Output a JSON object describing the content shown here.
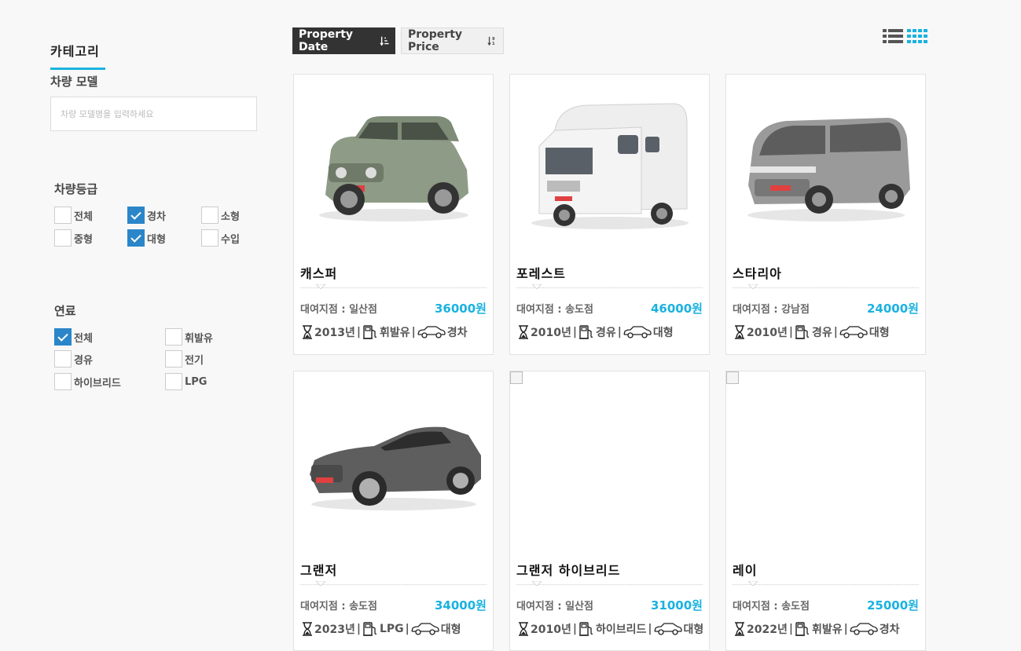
{
  "sidebar": {
    "category_title": "카테고리",
    "model_title": "차량 모델",
    "model_placeholder": "차량 모델명을 입력하세요",
    "grade_title": "차량등급",
    "grades": [
      {
        "label": "전체",
        "checked": false
      },
      {
        "label": "경차",
        "checked": true
      },
      {
        "label": "소형",
        "checked": false
      },
      {
        "label": "중형",
        "checked": false
      },
      {
        "label": "대형",
        "checked": true
      },
      {
        "label": "수입",
        "checked": false
      }
    ],
    "fuel_title": "연료",
    "fuels": [
      {
        "label": "전체",
        "checked": true
      },
      {
        "label": "휘발유",
        "checked": false
      },
      {
        "label": "경유",
        "checked": false
      },
      {
        "label": "전기",
        "checked": false
      },
      {
        "label": "하이브리드",
        "checked": false
      },
      {
        "label": "LPG",
        "checked": false
      }
    ]
  },
  "sort": {
    "date_label": "Property Date",
    "price_label": "Property Price"
  },
  "cars": [
    {
      "name": "캐스퍼",
      "branch": "대여지점 : 일산점",
      "price": "36000원",
      "year": "2013년",
      "fuel": "휘발유",
      "grade": "경차",
      "image": "casper"
    },
    {
      "name": "포레스트",
      "branch": "대여지점 : 송도점",
      "price": "46000원",
      "year": "2010년",
      "fuel": "경유",
      "grade": "대형",
      "image": "camper"
    },
    {
      "name": "스타리아",
      "branch": "대여지점 : 강남점",
      "price": "24000원",
      "year": "2010년",
      "fuel": "경유",
      "grade": "대형",
      "image": "van"
    },
    {
      "name": "그랜저",
      "branch": "대여지점 : 송도점",
      "price": "34000원",
      "year": "2023년",
      "fuel": "LPG",
      "grade": "대형",
      "image": "sedan"
    },
    {
      "name": "그랜저 하이브리드",
      "branch": "대여지점 : 일산점",
      "price": "31000원",
      "year": "2010년",
      "fuel": "하이브리드",
      "grade": "대형",
      "image": "broken"
    },
    {
      "name": "레이",
      "branch": "대여지점 : 송도점",
      "price": "25000원",
      "year": "2022년",
      "fuel": "휘발유",
      "grade": "경차",
      "image": "broken"
    }
  ],
  "colors": {
    "accent": "#1ab2e0",
    "check": "#2a86c9",
    "dark_button": "#333333"
  }
}
